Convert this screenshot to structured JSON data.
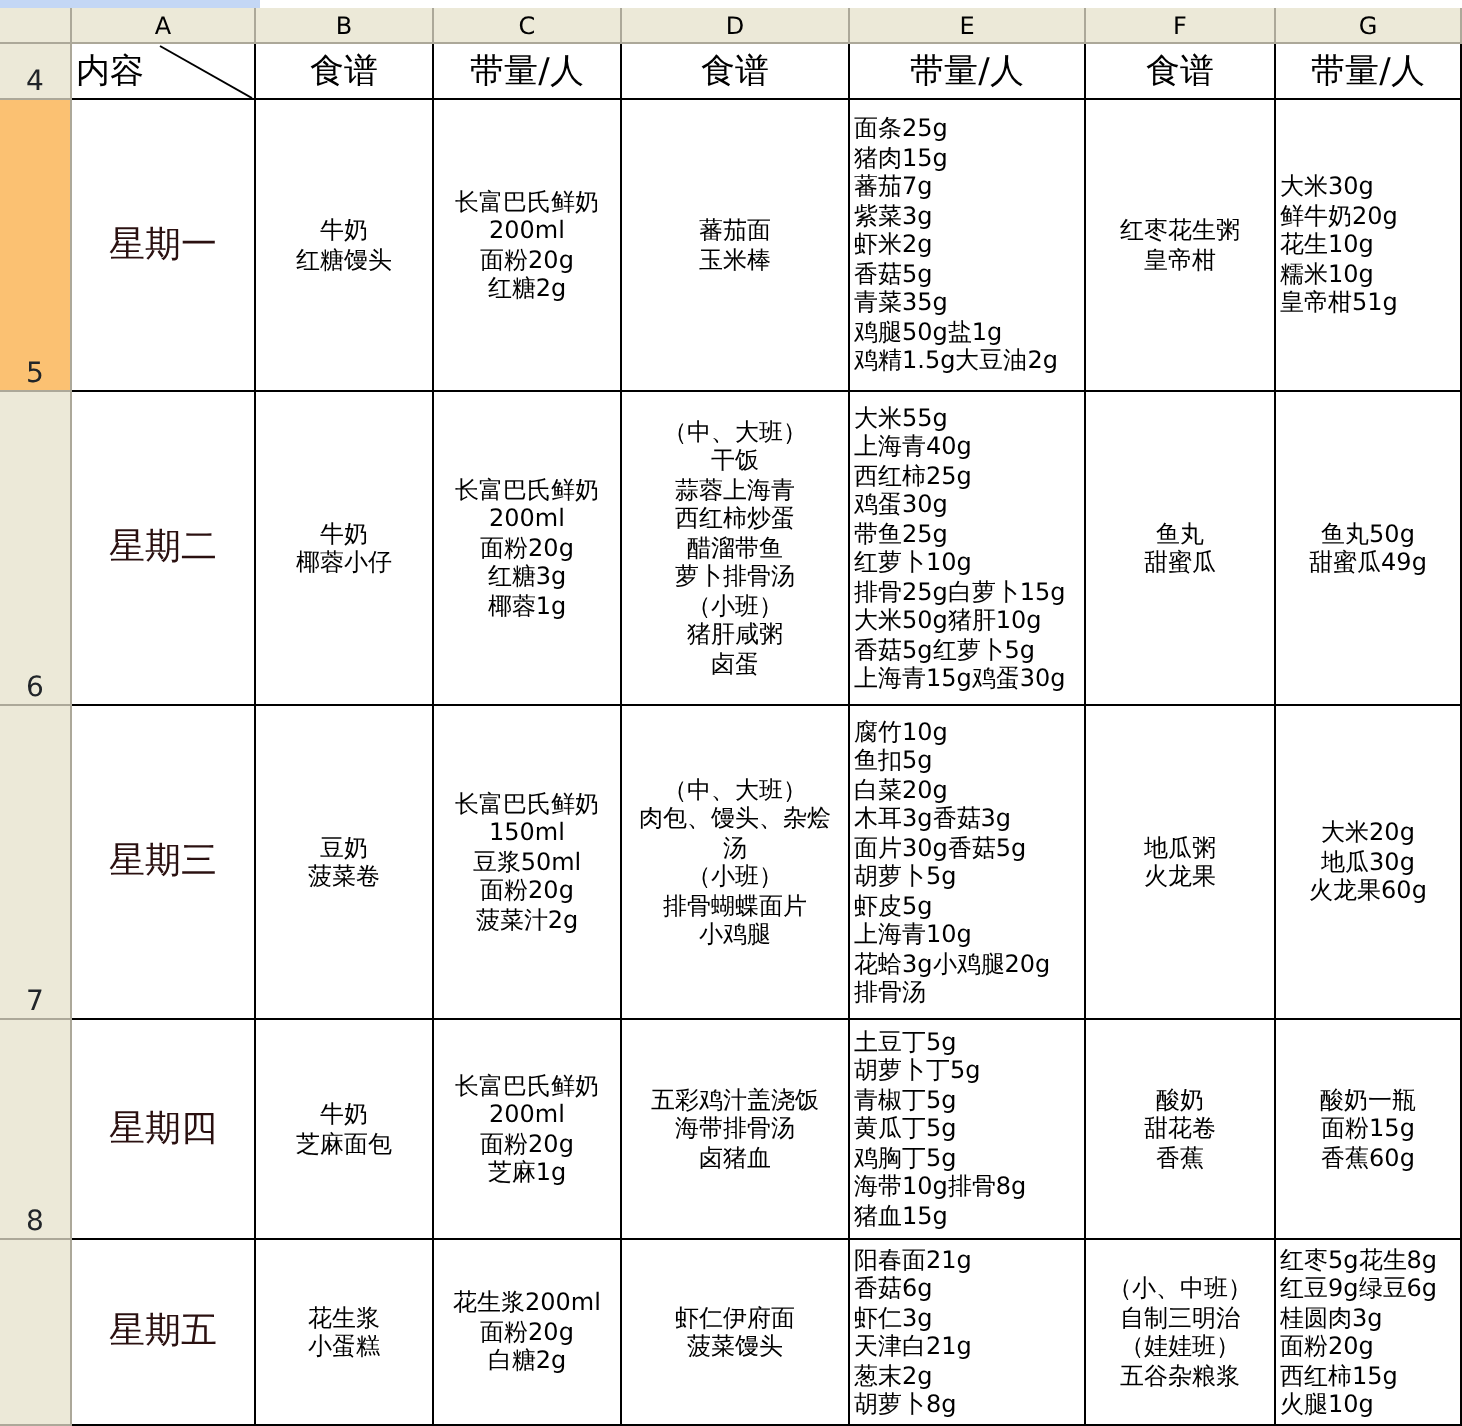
{
  "column_headers": [
    {
      "label": "A",
      "selected": false
    },
    {
      "label": "B",
      "selected": false
    },
    {
      "label": "C",
      "selected": false
    },
    {
      "label": "D",
      "selected": false
    },
    {
      "label": "E",
      "selected": false
    },
    {
      "label": "F",
      "selected": false
    },
    {
      "label": "G",
      "selected": false
    }
  ],
  "rows": [
    {
      "number": "4",
      "selected": false,
      "kind": "header",
      "cells": [
        {
          "kind": "list",
          "lines": [
            "内容"
          ]
        },
        {
          "kind": "centered",
          "lines": [
            "食谱"
          ]
        },
        {
          "kind": "centered",
          "lines": [
            "带量/人"
          ]
        },
        {
          "kind": "centered",
          "lines": [
            "食谱"
          ]
        },
        {
          "kind": "centered",
          "lines": [
            "带量/人"
          ]
        },
        {
          "kind": "centered",
          "lines": [
            "食谱"
          ]
        },
        {
          "kind": "centered",
          "lines": [
            "带量/人"
          ]
        }
      ]
    },
    {
      "number": "5",
      "selected": true,
      "kind": "day",
      "cells": [
        {
          "kind": "centered",
          "lines": [
            "星期一"
          ]
        },
        {
          "kind": "centered",
          "lines": [
            "牛奶",
            "红糖馒头"
          ]
        },
        {
          "kind": "centered",
          "lines": [
            "长富巴氏鲜奶",
            "200ml",
            "面粉20g",
            "红糖2g"
          ]
        },
        {
          "kind": "centered",
          "lines": [
            "蕃茄面",
            "玉米棒"
          ]
        },
        {
          "kind": "list",
          "lines": [
            "面条25g",
            "猪肉15g",
            "蕃茄7g",
            "紫菜3g",
            "虾米2g",
            "香菇5g",
            "青菜35g",
            "鸡腿50g盐1g",
            "鸡精1.5g大豆油2g"
          ]
        },
        {
          "kind": "centered",
          "lines": [
            "红枣花生粥",
            "皇帝柑"
          ]
        },
        {
          "kind": "list",
          "lines": [
            "大米30g",
            "鲜牛奶20g",
            "花生10g",
            "糯米10g",
            "皇帝柑51g"
          ]
        }
      ]
    },
    {
      "number": "6",
      "selected": false,
      "kind": "day",
      "cells": [
        {
          "kind": "centered",
          "lines": [
            "星期二"
          ]
        },
        {
          "kind": "centered",
          "lines": [
            "牛奶",
            "椰蓉小仔"
          ]
        },
        {
          "kind": "centered",
          "lines": [
            "长富巴氏鲜奶",
            "200ml",
            "面粉20g",
            "红糖3g",
            "椰蓉1g"
          ]
        },
        {
          "kind": "centered",
          "lines": [
            "（中、大班）",
            "干饭",
            "蒜蓉上海青",
            "西红柿炒蛋",
            "醋溜带鱼",
            "萝卜排骨汤",
            "（小班）",
            "猪肝咸粥",
            "卤蛋"
          ]
        },
        {
          "kind": "list",
          "lines": [
            "大米55g",
            "上海青40g",
            "西红柿25g",
            "鸡蛋30g",
            "带鱼25g",
            "红萝卜10g",
            "排骨25g白萝卜15g",
            "大米50g猪肝10g",
            "香菇5g红萝卜5g",
            "上海青15g鸡蛋30g"
          ]
        },
        {
          "kind": "centered",
          "lines": [
            "鱼丸",
            "甜蜜瓜"
          ]
        },
        {
          "kind": "centered",
          "lines": [
            "鱼丸50g",
            "甜蜜瓜49g"
          ]
        }
      ]
    },
    {
      "number": "7",
      "selected": false,
      "kind": "day",
      "cells": [
        {
          "kind": "centered",
          "lines": [
            "星期三"
          ]
        },
        {
          "kind": "centered",
          "lines": [
            "豆奶",
            "菠菜卷"
          ]
        },
        {
          "kind": "centered",
          "lines": [
            "长富巴氏鲜奶",
            "150ml",
            "豆浆50ml",
            "面粉20g",
            "菠菜汁2g"
          ]
        },
        {
          "kind": "centered",
          "lines": [
            "（中、大班）",
            "肉包、馒头、杂烩",
            "汤",
            "（小班）",
            "排骨蝴蝶面片",
            "小鸡腿"
          ]
        },
        {
          "kind": "list",
          "lines": [
            "腐竹10g",
            "鱼扣5g",
            "白菜20g",
            "木耳3g香菇3g",
            "面片30g香菇5g",
            "胡萝卜5g",
            "虾皮5g",
            "上海青10g",
            "花蛤3g小鸡腿20g",
            "排骨汤"
          ]
        },
        {
          "kind": "centered",
          "lines": [
            "地瓜粥",
            "火龙果"
          ]
        },
        {
          "kind": "centered",
          "lines": [
            "大米20g",
            "地瓜30g",
            "火龙果60g"
          ]
        }
      ]
    },
    {
      "number": "8",
      "selected": false,
      "kind": "day",
      "cells": [
        {
          "kind": "centered",
          "lines": [
            "星期四"
          ]
        },
        {
          "kind": "centered",
          "lines": [
            "牛奶",
            "芝麻面包"
          ]
        },
        {
          "kind": "centered",
          "lines": [
            "长富巴氏鲜奶",
            "200ml",
            "面粉20g",
            "芝麻1g"
          ]
        },
        {
          "kind": "centered",
          "lines": [
            "五彩鸡汁盖浇饭",
            "海带排骨汤",
            "卤猪血"
          ]
        },
        {
          "kind": "list",
          "lines": [
            "土豆丁5g",
            "胡萝卜丁5g",
            "青椒丁5g",
            "黄瓜丁5g",
            "鸡胸丁5g",
            "海带10g排骨8g",
            "猪血15g"
          ]
        },
        {
          "kind": "centered",
          "lines": [
            "酸奶",
            "甜花卷",
            "香蕉"
          ]
        },
        {
          "kind": "centered",
          "lines": [
            "酸奶一瓶",
            "面粉15g",
            "香蕉60g"
          ]
        }
      ]
    },
    {
      "selected": false,
      "kind": "day",
      "cells": [
        {
          "kind": "centered",
          "lines": [
            "星期五"
          ]
        },
        {
          "kind": "centered",
          "lines": [
            "花生浆",
            "小蛋糕"
          ]
        },
        {
          "kind": "centered",
          "lines": [
            "花生浆200ml",
            "面粉20g",
            "白糖2g"
          ]
        },
        {
          "kind": "centered",
          "lines": [
            "虾仁伊府面",
            "菠菜馒头"
          ]
        },
        {
          "kind": "list",
          "lines": [
            "阳春面21g",
            "香菇6g",
            "虾仁3g",
            "天津白21g",
            "葱末2g",
            "胡萝卜8g"
          ]
        },
        {
          "kind": "centered",
          "lines": [
            "（小、中班）",
            "自制三明治",
            "（娃娃班）",
            "五谷杂粮浆"
          ]
        },
        {
          "kind": "list",
          "lines": [
            "红枣5g花生8g",
            "红豆9g绿豆6g",
            "桂圆肉3g",
            "面粉20g",
            "西红柿15g",
            "火腿10g"
          ]
        }
      ]
    }
  ]
}
